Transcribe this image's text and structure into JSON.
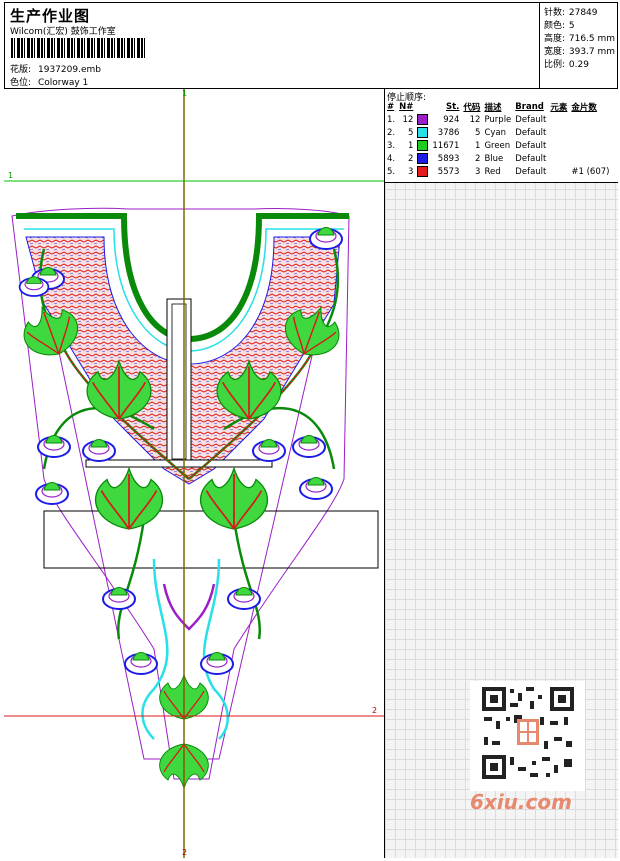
{
  "header": {
    "title": "生产作业图",
    "company": "Wilcom(汇宏) 鼓饰工作室",
    "pattern_label": "花版:",
    "pattern_value": "1937209.emb",
    "color_label": "色位:",
    "color_value": "Colorway 1"
  },
  "stats": {
    "stitches_label": "针数:",
    "stitches_value": "27849",
    "colors_label": "颜色:",
    "colors_value": "5",
    "height_label": "高度:",
    "height_value": "716.5 mm",
    "width_label": "宽度:",
    "width_value": "393.7 mm",
    "scale_label": "比例:",
    "scale_value": "0.29"
  },
  "stop_sequence": {
    "title": "停止顺序:",
    "headers": [
      "#",
      "N#",
      "",
      "St.",
      "代码",
      "描述",
      "Brand",
      "元素",
      "金片数"
    ],
    "rows": [
      {
        "idx": "1.",
        "n": "12",
        "color": "#9b1ec8",
        "st": "924",
        "code": "12",
        "desc": "Purple",
        "brand": "Default",
        "elem": "",
        "seq": ""
      },
      {
        "idx": "2.",
        "n": "5",
        "color": "#27e0e8",
        "st": "3786",
        "code": "5",
        "desc": "Cyan",
        "brand": "Default",
        "elem": "",
        "seq": ""
      },
      {
        "idx": "3.",
        "n": "1",
        "color": "#1ecc1e",
        "st": "11671",
        "code": "1",
        "desc": "Green",
        "brand": "Default",
        "elem": "",
        "seq": ""
      },
      {
        "idx": "4.",
        "n": "2",
        "color": "#1c1ce6",
        "st": "5893",
        "code": "2",
        "desc": "Blue",
        "brand": "Default",
        "elem": "",
        "seq": ""
      },
      {
        "idx": "5.",
        "n": "3",
        "color": "#e61c1c",
        "st": "5573",
        "code": "3",
        "desc": "Red",
        "brand": "Default",
        "elem": "",
        "seq": "#1 (607)"
      }
    ]
  },
  "guides": {
    "v_top": "1",
    "v_bottom": "2",
    "h_left": "1",
    "h_right": "2"
  },
  "watermark": "6xiu.com"
}
